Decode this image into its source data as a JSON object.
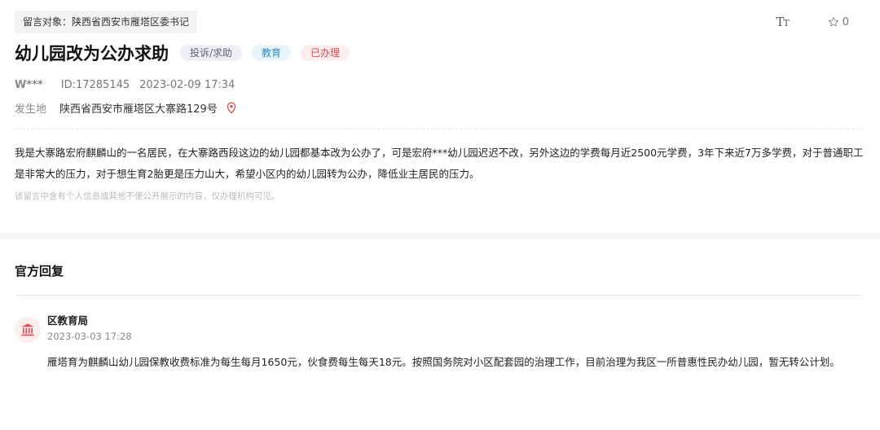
{
  "header": {
    "target_label": "留言对象：陕西省西安市雁塔区委书记",
    "font_tool_big": "T",
    "font_tool_small": "T",
    "favorite_count": "0"
  },
  "post": {
    "title": "幼儿园改为公办求助",
    "badges": {
      "type": "投诉/求助",
      "domain": "教育",
      "status": "已办理"
    },
    "user": "W***",
    "id": "ID:17285145",
    "datetime": "2023-02-09 17:34",
    "location_label": "发生地",
    "location": "陕西省西安市雁塔区大寨路129号",
    "content": "我是大寨路宏府麒麟山的一名居民，在大寨路西段这边的幼儿园都基本改为公办了，可是宏府***幼儿园迟迟不改，另外这边的学费每月近2500元学费，3年下来近7万多学费，对于普通职工是非常大的压力，对于想生育2胎更是压力山大，希望小区内的幼儿园转为公办，降低业主居民的压力。",
    "privacy_note": "该留言中含有个人信息或其他不便公开展示的内容，仅办理机构可见。"
  },
  "reply": {
    "section_title": "官方回复",
    "org": "区教育局",
    "time": "2023-03-03 17:28",
    "content": "雁塔育为麒麟山幼儿园保教收费标准为每生每月1650元，伙食费每生每天18元。按照国务院对小区配套园的治理工作，目前治理为我区一所普惠性民办幼儿园，暂无转公计划。"
  },
  "colors": {
    "status_red": "#e0474c",
    "domain_blue": "#2a8ac7",
    "pin_red": "#e0474c"
  }
}
